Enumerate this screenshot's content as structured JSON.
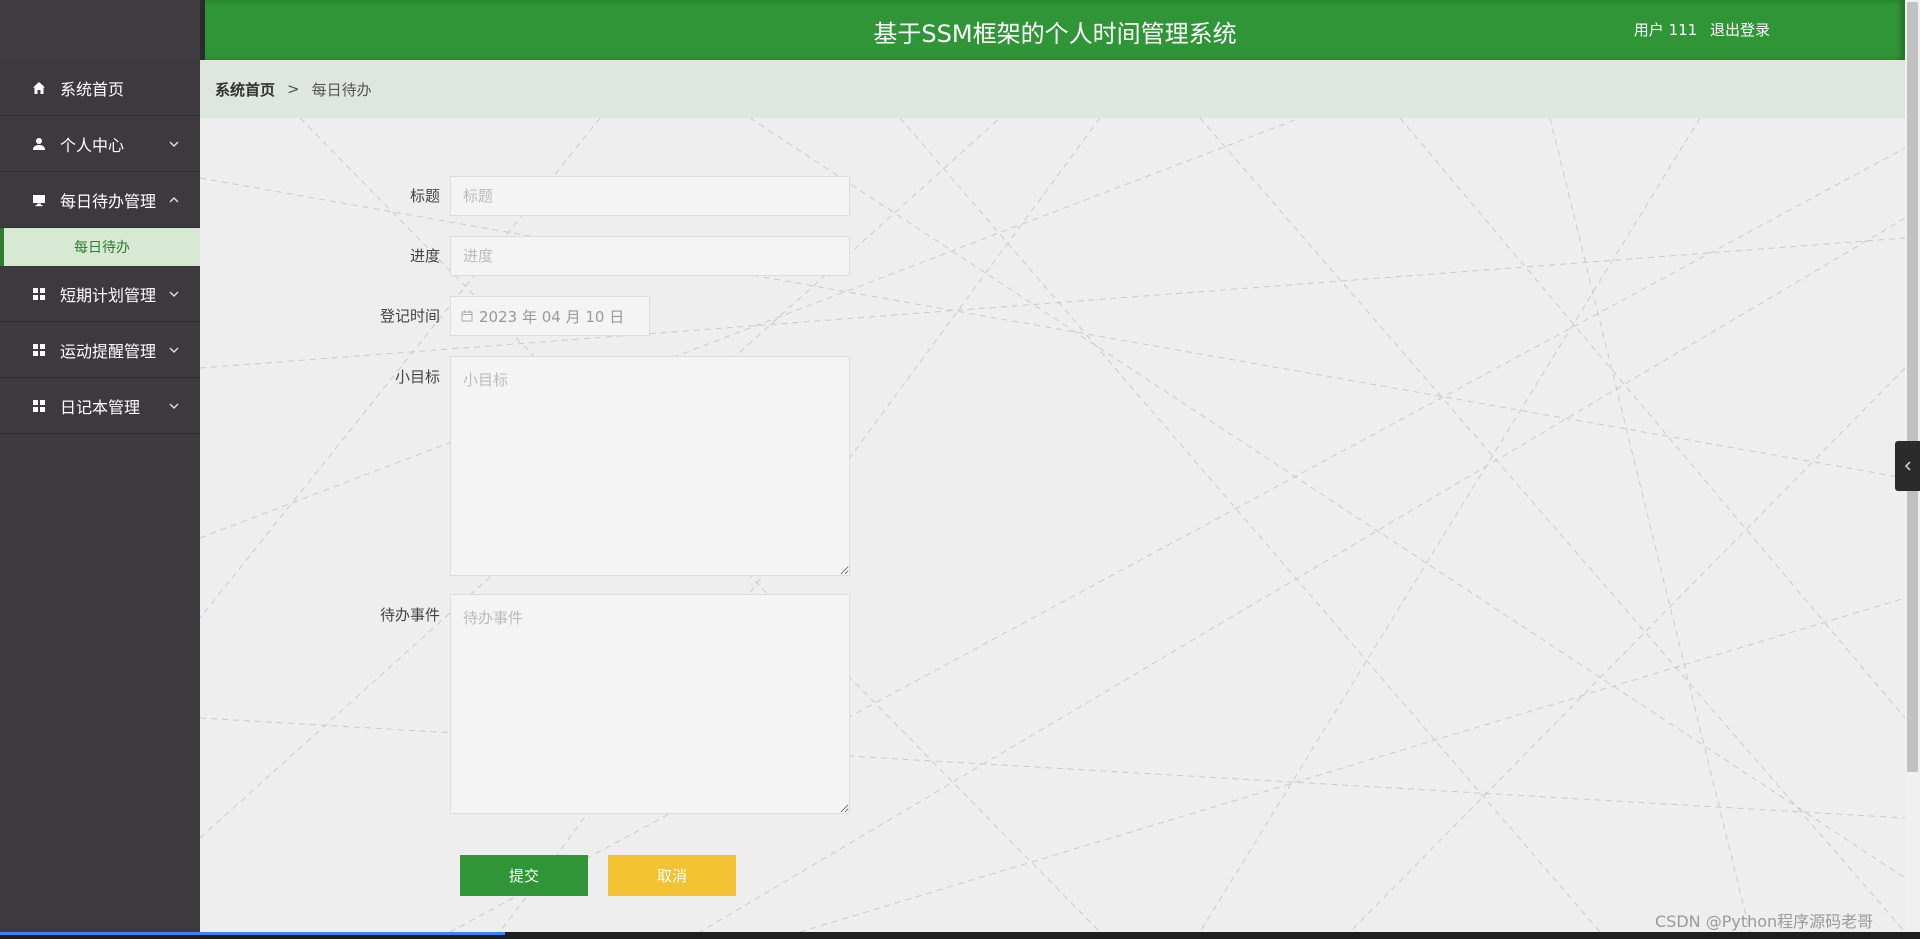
{
  "app": {
    "title": "基于SSM框架的个人时间管理系统",
    "user_label": "用户 111",
    "logout_label": "退出登录"
  },
  "sidebar": {
    "items": [
      {
        "label": "系统首页",
        "icon": "home-icon"
      },
      {
        "label": "个人中心",
        "icon": "user-icon"
      },
      {
        "label": "每日待办管理",
        "icon": "monitor-icon",
        "expanded": true
      },
      {
        "label": "短期计划管理",
        "icon": "grid-icon"
      },
      {
        "label": "运动提醒管理",
        "icon": "grid-icon"
      },
      {
        "label": "日记本管理",
        "icon": "grid-icon"
      }
    ],
    "sub_items": [
      {
        "label": "每日待办",
        "active": true
      }
    ]
  },
  "breadcrumb": {
    "home": "系统首页",
    "separator": ">",
    "current": "每日待办"
  },
  "form": {
    "title": {
      "label": "标题",
      "placeholder": "标题",
      "value": ""
    },
    "progress": {
      "label": "进度",
      "placeholder": "进度",
      "value": ""
    },
    "record_time": {
      "label": "登记时间",
      "value": "2023 年 04 月 10 日"
    },
    "goal": {
      "label": "小目标",
      "placeholder": "小目标",
      "value": ""
    },
    "todo": {
      "label": "待办事件",
      "placeholder": "待办事件",
      "value": ""
    },
    "submit_label": "提交",
    "cancel_label": "取消"
  },
  "watermark": "CSDN @Python程序源码老哥",
  "colors": {
    "primary": "#2f9536",
    "cancel": "#f2c232",
    "sidebar": "#3c3a3d",
    "breadcrumb_bg": "#dfe6df",
    "active_sub_bg": "#d7e8d3"
  }
}
